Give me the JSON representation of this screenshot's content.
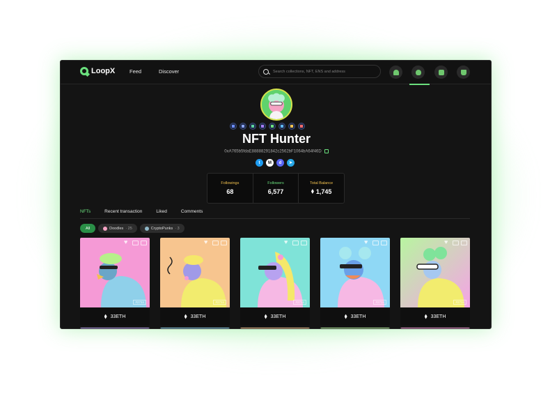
{
  "app": {
    "name": "LoopX"
  },
  "nav": {
    "feed": "Feed",
    "discover": "Discover"
  },
  "search": {
    "placeholder": "Search collections, NFT, ENS and address"
  },
  "profile": {
    "name": "NFT Hunter",
    "address": "0xA765b5fdaE88888291842c2562bF1064bA64f46D"
  },
  "stats": [
    {
      "label": "Followings",
      "value": "68",
      "color": "#f2c14e"
    },
    {
      "label": "Followers",
      "value": "6,577",
      "color": "#6be07e"
    },
    {
      "label": "Total Balance",
      "value": "1,745",
      "color": "#f2c14e"
    }
  ],
  "tabs": [
    "NFTs",
    "Recent transaction",
    "Liked",
    "Comments"
  ],
  "filters": {
    "all": "All",
    "doodles": {
      "label": "Doodles",
      "count": "· 25"
    },
    "punks": {
      "label": "CryptoPunks",
      "count": "· 3"
    }
  },
  "cards": [
    {
      "price": "33ETH",
      "tag": "#2734"
    },
    {
      "price": "33ETH",
      "tag": "#2734"
    },
    {
      "price": "33ETH",
      "tag": "#2734"
    },
    {
      "price": "33ETH",
      "tag": "#2734"
    },
    {
      "price": "33ETH",
      "tag": "#2734"
    }
  ],
  "colors": {
    "accent": "#6be07e",
    "background": "#141414"
  }
}
